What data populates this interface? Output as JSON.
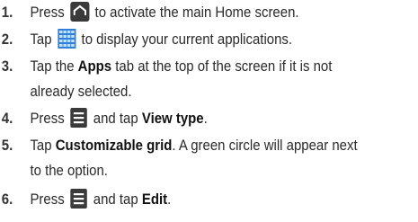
{
  "steps": [
    {
      "num": "1.",
      "line1_a": "Press",
      "line1_b": "to activate the main Home screen."
    },
    {
      "num": "2.",
      "line1_a": "Tap",
      "line1_b": "to display your current applications."
    },
    {
      "num": "3.",
      "line1_a": "Tap the",
      "bold1": "Apps",
      "line1_b": "tab at the top of the screen if it is not",
      "line2": "already selected."
    },
    {
      "num": "4.",
      "line1_a": "Press",
      "line1_b": "and tap",
      "bold1": "View type",
      "line1_c": "."
    },
    {
      "num": "5.",
      "line1_a": "Tap",
      "bold1": "Customizable grid",
      "line1_b": ". A green circle will appear next",
      "line2": "to the option."
    },
    {
      "num": "6.",
      "line1_a": "Press",
      "line1_b": "and tap",
      "bold1": "Edit",
      "line1_c": "."
    }
  ],
  "icons": {
    "home": "home-key-icon",
    "apps": "apps-grid-icon",
    "menu": "menu-key-icon",
    "home_color": "#3a3a3a",
    "apps_color": "#3b8fe0"
  }
}
